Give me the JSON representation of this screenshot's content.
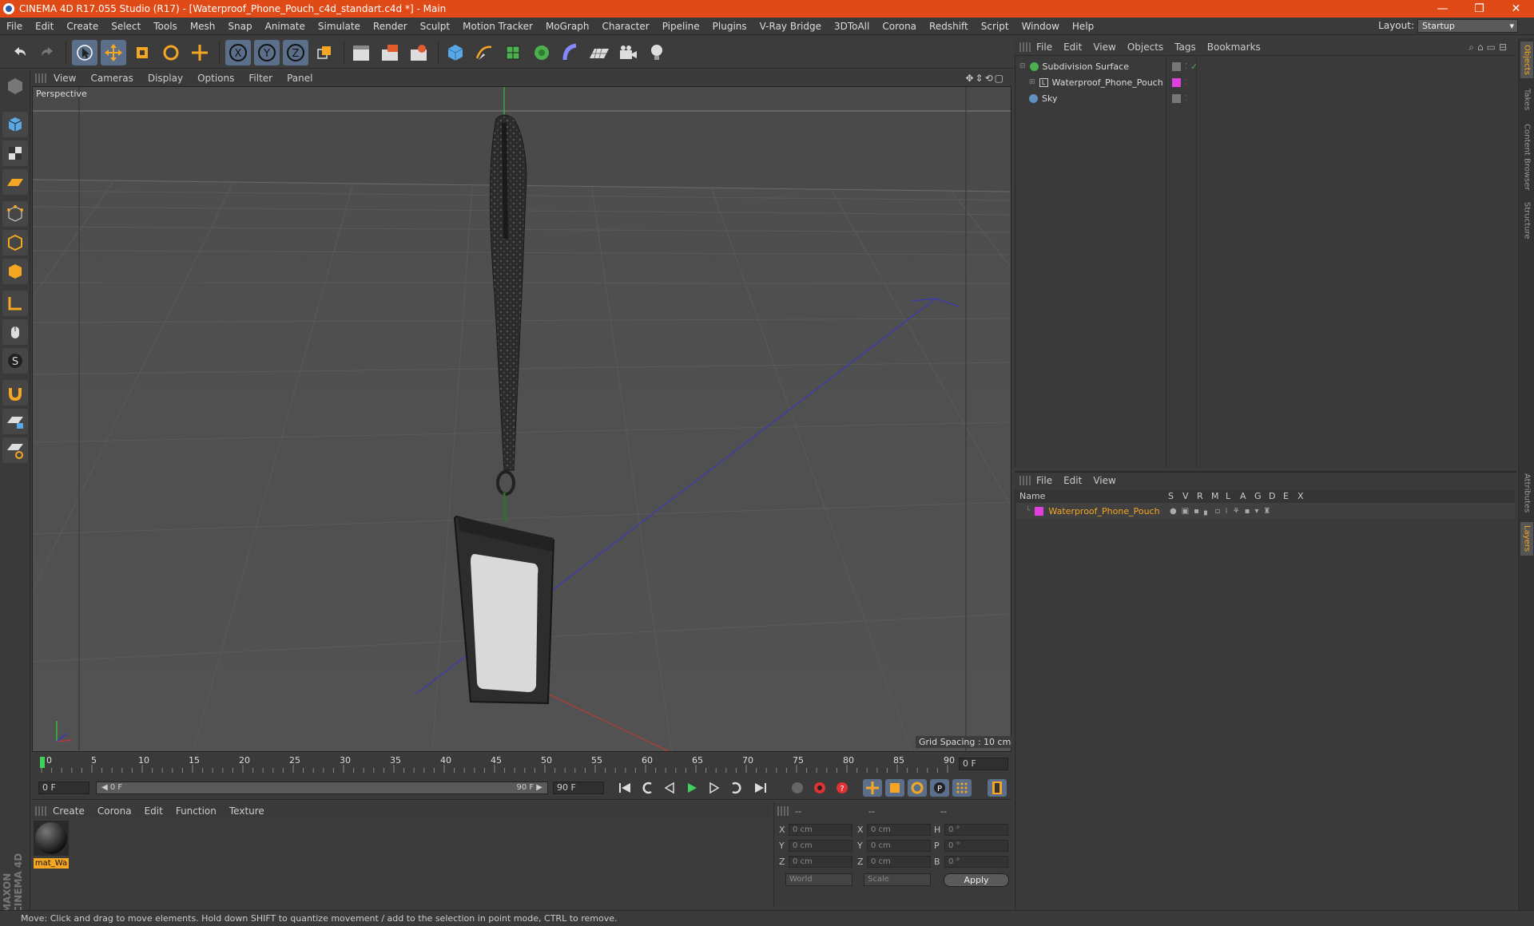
{
  "window": {
    "title": "CINEMA 4D R17.055 Studio (R17) - [Waterproof_Phone_Pouch_c4d_standart.c4d *] - Main",
    "min": "—",
    "restore": "❐",
    "close": "✕"
  },
  "menu": [
    "File",
    "Edit",
    "Create",
    "Select",
    "Tools",
    "Mesh",
    "Snap",
    "Animate",
    "Simulate",
    "Render",
    "Sculpt",
    "Motion Tracker",
    "MoGraph",
    "Character",
    "Pipeline",
    "Plugins",
    "V-Ray Bridge",
    "3DToAll",
    "Corona",
    "Redshift",
    "Script",
    "Window",
    "Help"
  ],
  "layout": {
    "label": "Layout:",
    "value": "Startup"
  },
  "viewport": {
    "menu": [
      "View",
      "Cameras",
      "Display",
      "Options",
      "Filter",
      "Panel"
    ],
    "label": "Perspective",
    "grid_spacing": "Grid Spacing : 10 cm"
  },
  "timeline": {
    "ticks": [
      "0",
      "5",
      "10",
      "15",
      "20",
      "25",
      "30",
      "35",
      "40",
      "45",
      "50",
      "55",
      "60",
      "65",
      "70",
      "75",
      "80",
      "85",
      "90"
    ],
    "current_frame": "0 F"
  },
  "transport": {
    "start": "0 F",
    "range_start": "◀ 0 F",
    "range_end": "90 F ▶",
    "end": "90 F"
  },
  "materials": {
    "menu": [
      "Create",
      "Corona",
      "Edit",
      "Function",
      "Texture"
    ],
    "items": [
      {
        "name": "mat_Wa"
      }
    ]
  },
  "coords": {
    "headers": [
      "--",
      "--",
      "--"
    ],
    "rows": [
      {
        "a": "X",
        "av": "0 cm",
        "b": "X",
        "bv": "0 cm",
        "c": "H",
        "cv": "0 °"
      },
      {
        "a": "Y",
        "av": "0 cm",
        "b": "Y",
        "bv": "0 cm",
        "c": "P",
        "cv": "0 °"
      },
      {
        "a": "Z",
        "av": "0 cm",
        "b": "Z",
        "bv": "0 cm",
        "c": "B",
        "cv": "0 °"
      }
    ],
    "world": "World",
    "scale": "Scale",
    "apply": "Apply"
  },
  "objects": {
    "menu": [
      "File",
      "Edit",
      "View",
      "Objects",
      "Tags",
      "Bookmarks"
    ],
    "items": [
      {
        "name": "Subdivision Surface",
        "color": "#4caf50"
      },
      {
        "name": "Waterproof_Phone_Pouch",
        "color": "#e040e0"
      },
      {
        "name": "Sky",
        "color": "#6090c0"
      }
    ]
  },
  "layers": {
    "menu": [
      "File",
      "Edit",
      "View"
    ],
    "columns": [
      "Name",
      "S",
      "V",
      "R",
      "M",
      "L",
      "A",
      "G",
      "D",
      "E",
      "X"
    ],
    "items": [
      {
        "name": "Waterproof_Phone_Pouch",
        "color": "#e040e0"
      }
    ]
  },
  "right_tabs": [
    "Objects",
    "Takes",
    "Content Browser",
    "Structure",
    "Attributes",
    "Layers"
  ],
  "brand": {
    "line1": "MAXON",
    "line2": "CINEMA 4D"
  },
  "status": "Move: Click and drag to move elements. Hold down SHIFT to quantize movement / add to the selection in point mode, CTRL to remove."
}
